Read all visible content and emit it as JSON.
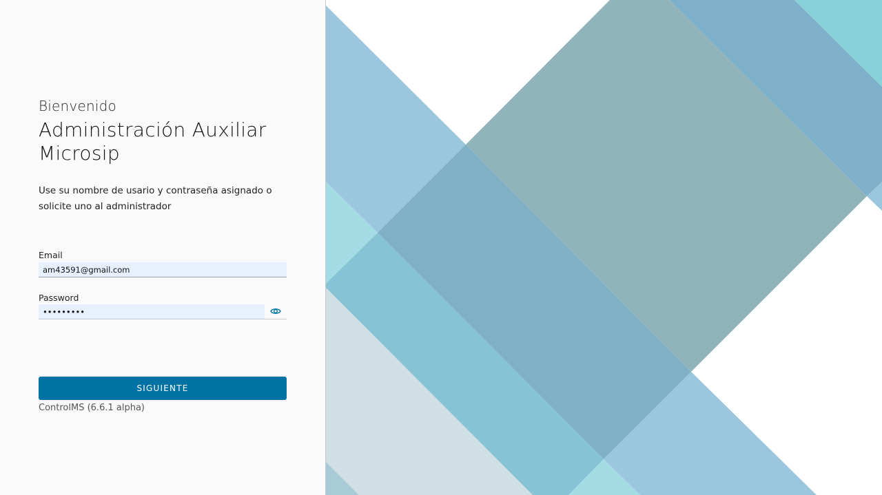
{
  "welcome": "Bienvenido",
  "title_line1": "Administración Auxiliar",
  "title_line2": "Microsip",
  "hint_line1": "Use su nombre de usario y contraseña asignado o",
  "hint_line2": "solicite uno al administrador",
  "email": {
    "label": "Email",
    "value": "am43591@gmail.com"
  },
  "password": {
    "label": "Password",
    "value": "•••••••••",
    "toggle_icon": "eye-icon"
  },
  "submit_label": "SIGUIENTE",
  "version": "ControlMS (6.6.1 alpha)",
  "colors": {
    "accent": "#0072a3",
    "panel_bg": "#fafafa",
    "input_bg": "#e8f0fe"
  }
}
